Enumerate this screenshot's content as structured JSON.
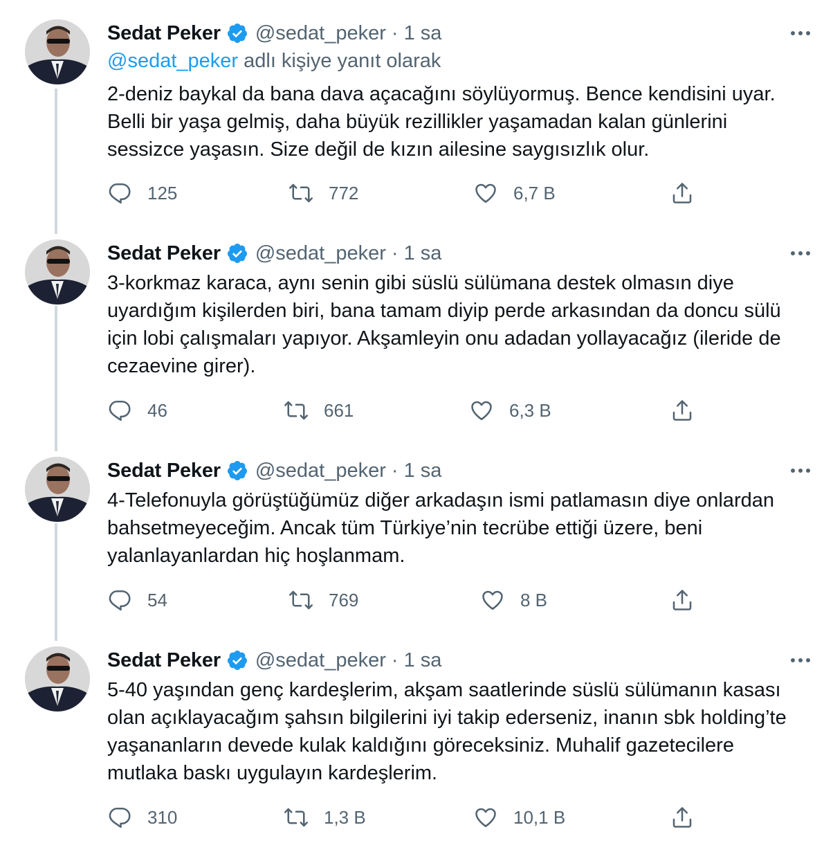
{
  "tweets": [
    {
      "name": "Sedat Peker",
      "handle": "@sedat_peker",
      "separator": "·",
      "time": "1 sa",
      "reply_to_handle": "@sedat_peker",
      "reply_to_text": " adlı kişiye yanıt olarak",
      "text": "2-deniz baykal da bana dava açacağını söylüyormuş. Bence kendisini uyar. Belli bir yaşa gelmiş, daha büyük rezillikler yaşamadan kalan günlerini sessizce yaşasın. Size değil de kızın ailesine saygısızlık olur.",
      "replies": "125",
      "retweets": "772",
      "likes": "6,7 B"
    },
    {
      "name": "Sedat Peker",
      "handle": "@sedat_peker",
      "separator": "·",
      "time": "1 sa",
      "text": "3-korkmaz karaca, aynı senin gibi süslü sülümana destek olmasın diye uyardığım kişilerden biri, bana tamam diyip perde arkasından da doncu sülü için lobi çalışmaları yapıyor. Akşamleyin onu adadan yollayacağız (ileride de cezaevine girer).",
      "replies": "46",
      "retweets": "661",
      "likes": "6,3 B"
    },
    {
      "name": "Sedat Peker",
      "handle": "@sedat_peker",
      "separator": "·",
      "time": "1 sa",
      "text": "4-Telefonuyla görüştüğümüz diğer arkadaşın ismi patlamasın diye onlardan bahsetmeyeceğim. Ancak tüm Türkiye’nin tecrübe ettiği üzere, beni yalanlayanlardan hiç hoşlanmam.",
      "replies": "54",
      "retweets": "769",
      "likes": "8 B"
    },
    {
      "name": "Sedat Peker",
      "handle": "@sedat_peker",
      "separator": "·",
      "time": "1 sa",
      "text": "5-40 yaşından genç kardeşlerim, akşam saatlerinde süslü sülümanın kasası olan açıklayacağım şahsın bilgilerini iyi takip ederseniz, inanın sbk holding’te yaşananların devede kulak kaldığını göreceksiniz. Muhalif gazetecilere mutlaka baskı uygulayın kardeşlerim.",
      "replies": "310",
      "retweets": "1,3 B",
      "likes": "10,1 B"
    }
  ],
  "icons": {
    "verified": "verified-badge-icon",
    "more": "more-icon",
    "reply": "reply-icon",
    "retweet": "retweet-icon",
    "like": "like-icon",
    "share": "share-icon"
  },
  "colors": {
    "link": "#1d9bf0",
    "secondary_text": "#536471",
    "thread_line": "#cfd9de"
  }
}
